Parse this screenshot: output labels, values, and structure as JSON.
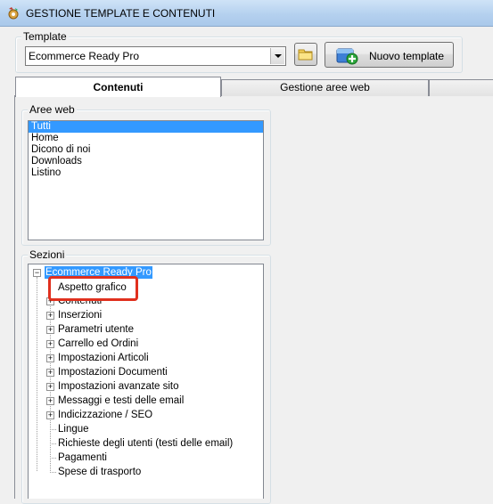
{
  "window": {
    "title": "GESTIONE TEMPLATE E CONTENUTI"
  },
  "template_group": {
    "legend": "Template",
    "selected_template": "Ecommerce Ready Pro",
    "new_template_label": "Nuovo template"
  },
  "tabs": [
    {
      "label": "Contenuti",
      "active": true
    },
    {
      "label": "Gestione aree web",
      "active": false
    }
  ],
  "aree_web": {
    "legend": "Aree web",
    "items": [
      "Tutti",
      "Home",
      "Dicono di noi",
      "Downloads",
      "Listino"
    ],
    "selected": "Tutti"
  },
  "sezioni": {
    "legend": "Sezioni",
    "root": "Ecommerce Ready Pro",
    "items": [
      {
        "label": "Aspetto grafico",
        "expandable": false
      },
      {
        "label": "Contenuti",
        "expandable": true
      },
      {
        "label": "Inserzioni",
        "expandable": true
      },
      {
        "label": "Parametri utente",
        "expandable": true
      },
      {
        "label": "Carrello ed Ordini",
        "expandable": true
      },
      {
        "label": "Impostazioni Articoli",
        "expandable": true
      },
      {
        "label": "Impostazioni Documenti",
        "expandable": true
      },
      {
        "label": "Impostazioni avanzate sito",
        "expandable": true
      },
      {
        "label": "Messaggi e testi delle email",
        "expandable": true
      },
      {
        "label": "Indicizzazione / SEO",
        "expandable": true
      },
      {
        "label": "Lingue",
        "expandable": false
      },
      {
        "label": "Richieste degli utenti (testi delle email)",
        "expandable": false
      },
      {
        "label": "Pagamenti",
        "expandable": false
      },
      {
        "label": "Spese di trasporto",
        "expandable": false
      }
    ]
  },
  "colors": {
    "selection": "#3399ff",
    "highlight_border": "#e0301e"
  }
}
